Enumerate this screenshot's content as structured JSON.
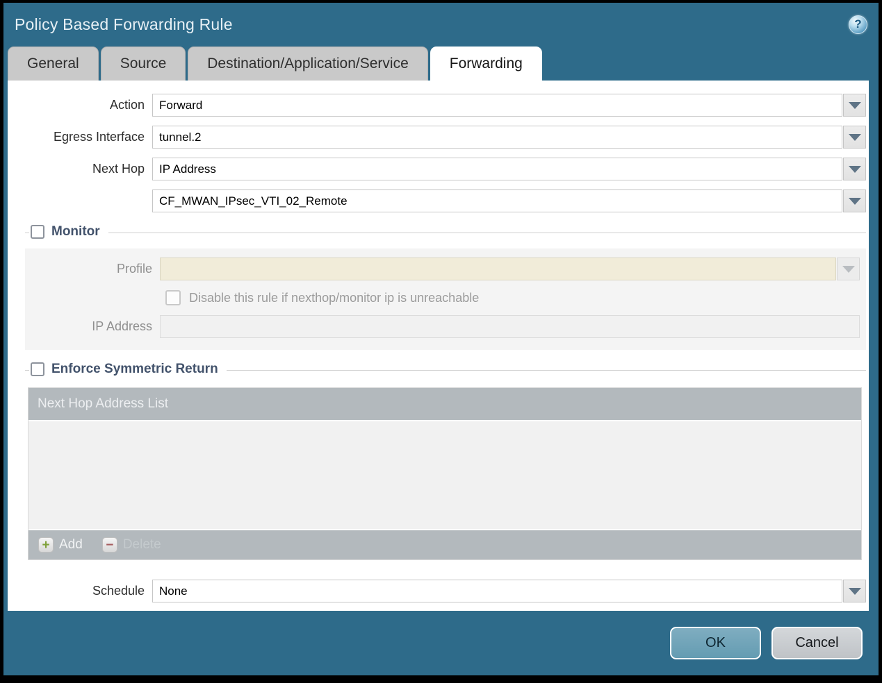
{
  "window": {
    "title": "Policy Based Forwarding Rule",
    "help_glyph": "?"
  },
  "tabs": [
    {
      "label": "General",
      "active": false
    },
    {
      "label": "Source",
      "active": false
    },
    {
      "label": "Destination/Application/Service",
      "active": false
    },
    {
      "label": "Forwarding",
      "active": true
    }
  ],
  "form": {
    "action": {
      "label": "Action",
      "value": "Forward"
    },
    "egress_interface": {
      "label": "Egress Interface",
      "value": "tunnel.2"
    },
    "next_hop": {
      "label": "Next Hop",
      "value": "IP Address"
    },
    "next_hop_address": {
      "value": "CF_MWAN_IPsec_VTI_02_Remote"
    },
    "schedule": {
      "label": "Schedule",
      "value": "None"
    }
  },
  "monitor": {
    "legend": "Monitor",
    "checked": false,
    "profile": {
      "label": "Profile",
      "value": ""
    },
    "disable_rule": {
      "label": "Disable this rule if nexthop/monitor ip is unreachable",
      "checked": false
    },
    "ip_address": {
      "label": "IP Address",
      "value": ""
    }
  },
  "enforce": {
    "legend": "Enforce Symmetric Return",
    "checked": false,
    "table": {
      "header": "Next Hop Address List",
      "rows": []
    },
    "add_label": "Add",
    "delete_label": "Delete",
    "add_glyph": "+",
    "delete_glyph": "−"
  },
  "buttons": {
    "ok": "OK",
    "cancel": "Cancel"
  },
  "colors": {
    "window_teal": "#2e6b8a",
    "active_tab": "#ffffff",
    "inactive_tab": "#c9c9c9",
    "disabled_field_beige": "#f1ecd9",
    "table_bar_gray": "#b3b9bd",
    "ok_button": "#6fa2b7",
    "cancel_button": "#c9cdd1",
    "add_plus_green": "#7fa13a",
    "delete_minus_red": "#a65c5e"
  }
}
